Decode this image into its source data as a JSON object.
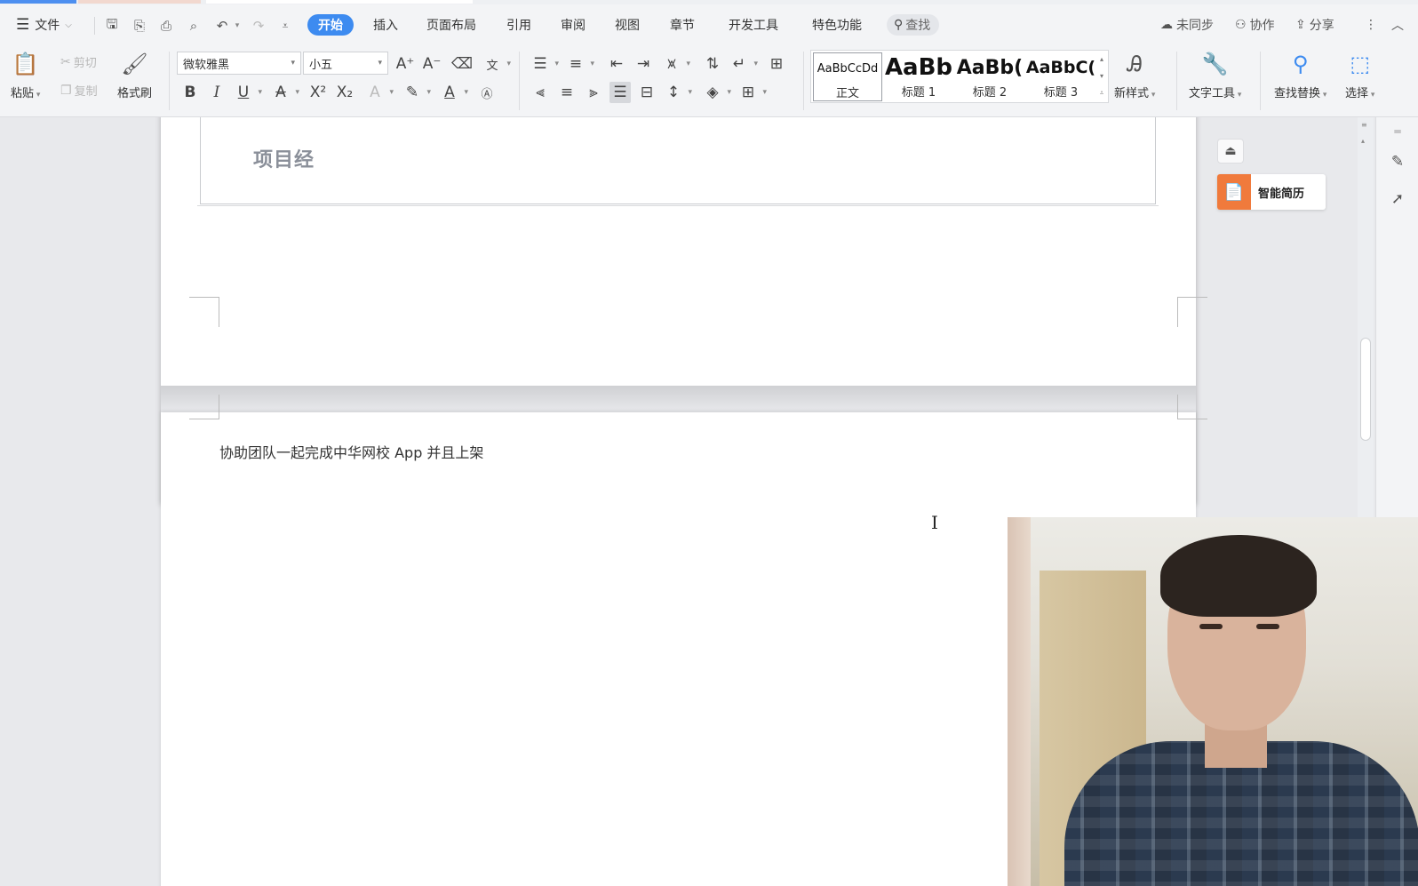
{
  "menubar": {
    "file_label": "文件",
    "tabs": [
      "开始",
      "插入",
      "页面布局",
      "引用",
      "审阅",
      "视图",
      "章节",
      "开发工具",
      "特色功能"
    ],
    "active_tab": "开始",
    "search_label": "查找",
    "sync_label": "未同步",
    "collab_label": "协作",
    "share_label": "分享"
  },
  "ribbon": {
    "paste_label": "粘贴",
    "cut_label": "剪切",
    "copy_label": "复制",
    "format_painter_label": "格式刷",
    "font_name": "微软雅黑",
    "font_size": "小五",
    "styles": [
      {
        "preview": "AaBbCcDd",
        "name": "正文"
      },
      {
        "preview": "AaBb",
        "name": "标题 1"
      },
      {
        "preview": "AaBb(",
        "name": "标题 2"
      },
      {
        "preview": "AaBbC(",
        "name": "标题 3"
      }
    ],
    "new_style_label": "新样式",
    "text_tools_label": "文字工具",
    "find_replace_label": "查找替换",
    "select_label": "选择"
  },
  "document": {
    "section_heading": "项目经",
    "body_line": "协助团队一起完成中华网校 App 并且上架"
  },
  "side_panel": {
    "smart_resume_label": "智能简历"
  },
  "colors": {
    "accent": "#3d8bf0",
    "resume_badge": "#f07a3c"
  }
}
